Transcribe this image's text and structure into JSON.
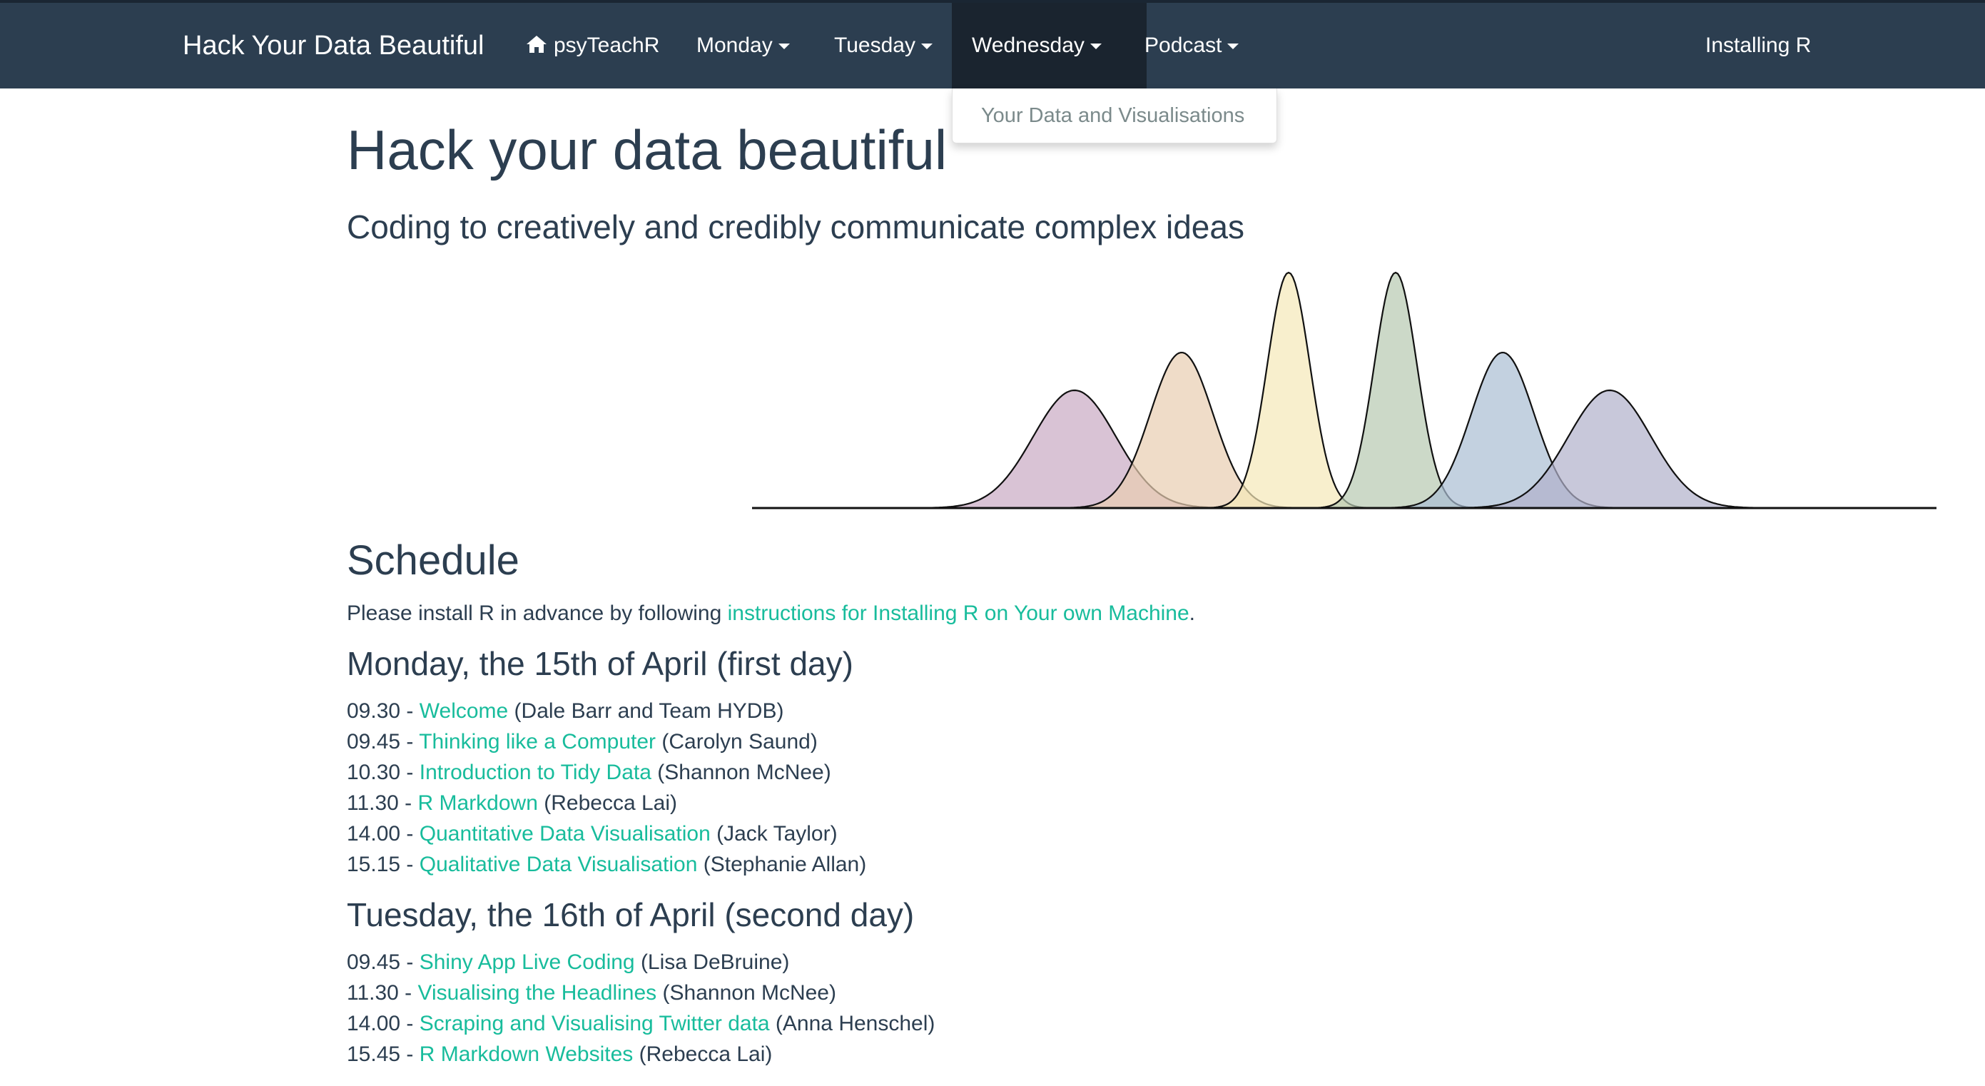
{
  "navbar": {
    "brand": "Hack Your Data Beautiful",
    "home_label": "psyTeachR",
    "menus": [
      {
        "label": "Monday"
      },
      {
        "label": "Tuesday"
      },
      {
        "label": "Wednesday",
        "open": true
      },
      {
        "label": "Podcast"
      }
    ],
    "right_link": "Installing R"
  },
  "dropdown": {
    "items": [
      "Your Data and Visualisations"
    ]
  },
  "page": {
    "title": "Hack your data beautiful",
    "subtitle": "Coding to creatively and credibly communicate complex ideas"
  },
  "header_figure": {
    "curve_colors": [
      "#c9a9c3",
      "#e8cdb0",
      "#f5e8b8",
      "#b6c9b0",
      "#a9bdd3",
      "#b1b0cb"
    ]
  },
  "schedule": {
    "heading": "Schedule",
    "intro_before": "Please install R in advance by following ",
    "intro_link": "instructions for Installing R on Your own Machine",
    "intro_after": ".",
    "days": [
      {
        "title": "Monday, the 15th of April (first day)",
        "sessions": [
          {
            "time": "09.30 - ",
            "title": "Welcome",
            "speaker": " (Dale Barr and Team HYDB)"
          },
          {
            "time": "09.45 - ",
            "title": "Thinking like a Computer",
            "speaker": " (Carolyn Saund)"
          },
          {
            "time": "10.30 - ",
            "title": "Introduction to Tidy Data",
            "speaker": " (Shannon McNee)"
          },
          {
            "time": "11.30 - ",
            "title": "R Markdown",
            "speaker": " (Rebecca Lai)"
          },
          {
            "time": "14.00 - ",
            "title": "Quantitative Data Visualisation",
            "speaker": " (Jack Taylor)"
          },
          {
            "time": "15.15 - ",
            "title": "Qualitative Data Visualisation",
            "speaker": " (Stephanie Allan)"
          }
        ]
      },
      {
        "title": "Tuesday, the 16th of April (second day)",
        "sessions": [
          {
            "time": "09.45 - ",
            "title": "Shiny App Live Coding",
            "speaker": " (Lisa DeBruine)"
          },
          {
            "time": "11.30 - ",
            "title": "Visualising the Headlines",
            "speaker": " (Shannon McNee)"
          },
          {
            "time": "14.00 - ",
            "title": "Scraping and Visualising Twitter data",
            "speaker": " (Anna Henschel)"
          },
          {
            "time": "15.45 - ",
            "title": "R Markdown Websites",
            "speaker": " (Rebecca Lai)"
          }
        ]
      }
    ]
  }
}
